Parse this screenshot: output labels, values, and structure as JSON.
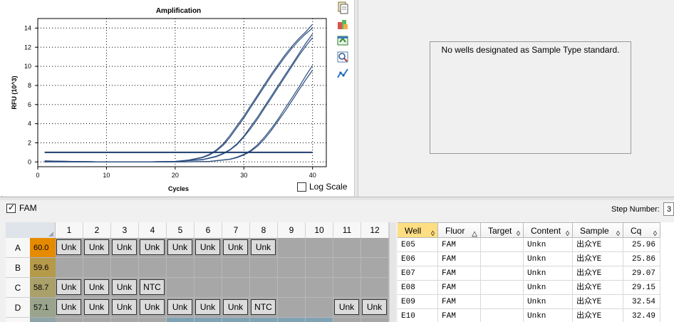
{
  "chart_data": {
    "type": "line",
    "title": "Amplification",
    "xlabel": "Cycles",
    "ylabel": "RFU (10^3)",
    "xlim": [
      0,
      42
    ],
    "ylim": [
      -0.5,
      15
    ],
    "xticks": [
      0,
      10,
      20,
      30,
      40
    ],
    "yticks": [
      0,
      2,
      4,
      6,
      8,
      10,
      12,
      14
    ],
    "grid": true,
    "threshold": 1.0,
    "series": [
      {
        "color": "#2e4e7e",
        "x": [
          1,
          5,
          10,
          15,
          20,
          22,
          24,
          25,
          26,
          27,
          28,
          29,
          30,
          31,
          32,
          33,
          34,
          35,
          36,
          37,
          38,
          39,
          40
        ],
        "y": [
          0.1,
          0.05,
          0,
          0,
          0.05,
          0.2,
          0.5,
          0.8,
          1.25,
          1.9,
          2.8,
          3.8,
          4.8,
          5.9,
          7.0,
          8.1,
          9.2,
          10.2,
          11.2,
          12.1,
          12.9,
          13.6,
          14.4
        ]
      },
      {
        "color": "#2e4e7e",
        "x": [
          1,
          5,
          10,
          15,
          20,
          22,
          24,
          25,
          26,
          27,
          28,
          29,
          30,
          31,
          32,
          33,
          34,
          35,
          36,
          37,
          38,
          39,
          40
        ],
        "y": [
          0.1,
          0.05,
          0,
          0,
          0.05,
          0.18,
          0.45,
          0.72,
          1.15,
          1.75,
          2.6,
          3.6,
          4.6,
          5.7,
          6.8,
          7.9,
          9.0,
          10.0,
          11.0,
          11.9,
          12.7,
          13.4,
          14.0
        ]
      },
      {
        "color": "#2e4e7e",
        "x": [
          1,
          5,
          10,
          15,
          20,
          24,
          26,
          27,
          28,
          29,
          30,
          31,
          32,
          33,
          34,
          35,
          36,
          37,
          38,
          39,
          40
        ],
        "y": [
          0.05,
          0.05,
          0,
          0,
          0.05,
          0.25,
          0.6,
          0.9,
          1.3,
          1.9,
          2.7,
          3.7,
          4.7,
          5.8,
          6.9,
          8.0,
          9.1,
          10.2,
          11.3,
          12.4,
          13.4
        ]
      },
      {
        "color": "#2e4e7e",
        "x": [
          1,
          5,
          10,
          15,
          20,
          24,
          26,
          27,
          28,
          29,
          30,
          31,
          32,
          33,
          34,
          35,
          36,
          37,
          38,
          39,
          40
        ],
        "y": [
          0.05,
          0.05,
          0,
          0,
          0.05,
          0.22,
          0.55,
          0.85,
          1.25,
          1.8,
          2.6,
          3.5,
          4.5,
          5.6,
          6.7,
          7.8,
          8.9,
          10.0,
          11.1,
          12.1,
          13.0
        ]
      },
      {
        "color": "#2e4e7e",
        "x": [
          1,
          5,
          10,
          15,
          20,
          25,
          28,
          29,
          30,
          31,
          32,
          33,
          34,
          35,
          36,
          37,
          38,
          39,
          40
        ],
        "y": [
          0,
          0,
          0,
          0,
          0,
          0.05,
          0.3,
          0.5,
          0.8,
          1.2,
          1.8,
          2.6,
          3.5,
          4.5,
          5.6,
          6.7,
          7.8,
          9.0,
          10.1
        ]
      },
      {
        "color": "#2e4e7e",
        "x": [
          1,
          5,
          10,
          15,
          20,
          25,
          28,
          29,
          30,
          31,
          32,
          33,
          34,
          35,
          36,
          37,
          38,
          39,
          40
        ],
        "y": [
          0,
          0,
          0,
          0,
          0,
          0.05,
          0.27,
          0.45,
          0.72,
          1.1,
          1.65,
          2.4,
          3.3,
          4.3,
          5.3,
          6.4,
          7.5,
          8.6,
          9.6
        ]
      }
    ]
  },
  "toolbar": {
    "icons": [
      "copy-icon",
      "export-icon",
      "refresh-icon",
      "zoom-icon",
      "analysis-icon"
    ]
  },
  "chart_options": {
    "log_scale_label": "Log Scale",
    "log_scale_checked": false
  },
  "std_curve": {
    "message": "No wells designated as Sample Type standard."
  },
  "fluor_bar": {
    "fam_label": "FAM",
    "fam_checked": true,
    "step_label": "Step Number:",
    "step_value": "3"
  },
  "plate": {
    "columns": [
      "1",
      "2",
      "3",
      "4",
      "5",
      "6",
      "7",
      "8",
      "9",
      "10",
      "11",
      "12"
    ],
    "rows": [
      {
        "letter": "A",
        "temp": "60.0",
        "temp_color": "#e68a00",
        "wells": [
          "Unk",
          "Unk",
          "Unk",
          "Unk",
          "Unk",
          "Unk",
          "Unk",
          "Unk",
          "",
          "",
          "",
          ""
        ]
      },
      {
        "letter": "B",
        "temp": "59.6",
        "temp_color": "#b59a4a",
        "wells": [
          "",
          "",
          "",
          "",
          "",
          "",
          "",
          "",
          "",
          "",
          "",
          ""
        ]
      },
      {
        "letter": "C",
        "temp": "58.7",
        "temp_color": "#a9a06a",
        "wells": [
          "Unk",
          "Unk",
          "Unk",
          "NTC",
          "",
          "",
          "",
          "",
          "",
          "",
          "",
          ""
        ]
      },
      {
        "letter": "D",
        "temp": "57.1",
        "temp_color": "#9aa38c",
        "wells": [
          "Unk",
          "Unk",
          "Unk",
          "Unk",
          "Unk",
          "Unk",
          "Unk",
          "NTC",
          "",
          "",
          "Unk",
          "Unk"
        ]
      },
      {
        "letter": "",
        "temp": "",
        "temp_color": "#8ea4a8",
        "wells": [
          "",
          "",
          "",
          "",
          "",
          "",
          "",
          "",
          "",
          "",
          "",
          ""
        ]
      }
    ]
  },
  "results_table": {
    "columns": [
      {
        "label": "Well",
        "sort": "◊"
      },
      {
        "label": "Fluor",
        "sort": "△"
      },
      {
        "label": "Target",
        "sort": "◊"
      },
      {
        "label": "Content",
        "sort": "◊"
      },
      {
        "label": "Sample",
        "sort": "◊"
      },
      {
        "label": "Cq",
        "sort": "◊"
      }
    ],
    "rows": [
      [
        "E05",
        "FAM",
        "",
        "Unkn",
        "出众YE",
        "25.96"
      ],
      [
        "E06",
        "FAM",
        "",
        "Unkn",
        "出众YE",
        "25.86"
      ],
      [
        "E07",
        "FAM",
        "",
        "Unkn",
        "出众YE",
        "29.07"
      ],
      [
        "E08",
        "FAM",
        "",
        "Unkn",
        "出众YE",
        "29.15"
      ],
      [
        "E09",
        "FAM",
        "",
        "Unkn",
        "出众YE",
        "32.54"
      ],
      [
        "E10",
        "FAM",
        "",
        "Unkn",
        "出众YE",
        "32.49"
      ]
    ]
  }
}
